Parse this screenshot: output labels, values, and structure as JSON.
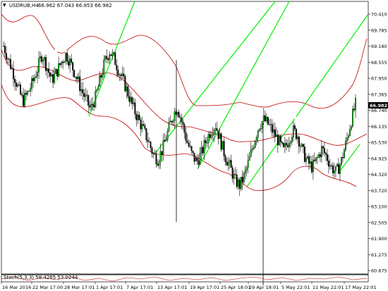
{
  "header": {
    "symbol_label": "USDRUB,H4",
    "ohlc_text": "66.962 67.043 66.853 66.982",
    "dropdown_glyph": "▼"
  },
  "indicator": {
    "label": "Stoch(5,3,3) 58.4265 53.0244"
  },
  "current_price": "66.982",
  "colors": {
    "candle": "#000000",
    "band": "#c00000",
    "trendline": "#00ee00",
    "level": "#ffffff"
  },
  "chart_data": {
    "type": "candlestick",
    "symbol": "USDRUB",
    "timeframe": "H4",
    "ylim": [
      60.675,
      70.41
    ],
    "y_ticks": [
      "70.410",
      "69.785",
      "69.180",
      "68.555",
      "67.950",
      "67.365",
      "66.740",
      "66.135",
      "65.530",
      "64.925",
      "64.320",
      "63.720",
      "63.100",
      "62.505",
      "61.900",
      "61.275",
      "60.675"
    ],
    "x_ticks": [
      "16 Mar 2016",
      "22 Mar 17:00",
      "28 Mar 17:01",
      "1 Apr 17:01",
      "7 Apr 17:01",
      "13 Apr 17:01",
      "19 Apr 17:01",
      "25 Apr 18:01",
      "29 Apr 18:01",
      "5 May 22:01",
      "11 May 22:01",
      "17 May 22:01"
    ],
    "close_path": [
      69.2,
      68.7,
      68.2,
      67.6,
      67.1,
      67.4,
      67.8,
      68.3,
      68.9,
      68.4,
      67.9,
      68.2,
      68.6,
      68.9,
      68.5,
      68.1,
      67.6,
      67.2,
      66.8,
      67.2,
      67.9,
      68.6,
      69.0,
      68.7,
      68.2,
      67.8,
      67.3,
      66.8,
      66.4,
      66.0,
      65.6,
      65.1,
      64.9,
      65.3,
      65.9,
      66.5,
      66.9,
      66.3,
      65.6,
      65.1,
      64.8,
      65.1,
      65.6,
      66.0,
      66.2,
      65.6,
      65.0,
      64.6,
      64.1,
      63.9,
      64.3,
      64.9,
      65.6,
      66.2,
      66.4,
      66.2,
      65.9,
      65.6,
      65.2,
      65.6,
      66.0,
      65.8,
      65.2,
      64.8,
      64.6,
      64.9,
      65.3,
      65.0,
      64.6,
      64.4,
      64.8,
      65.5,
      66.3,
      66.98
    ]
  }
}
